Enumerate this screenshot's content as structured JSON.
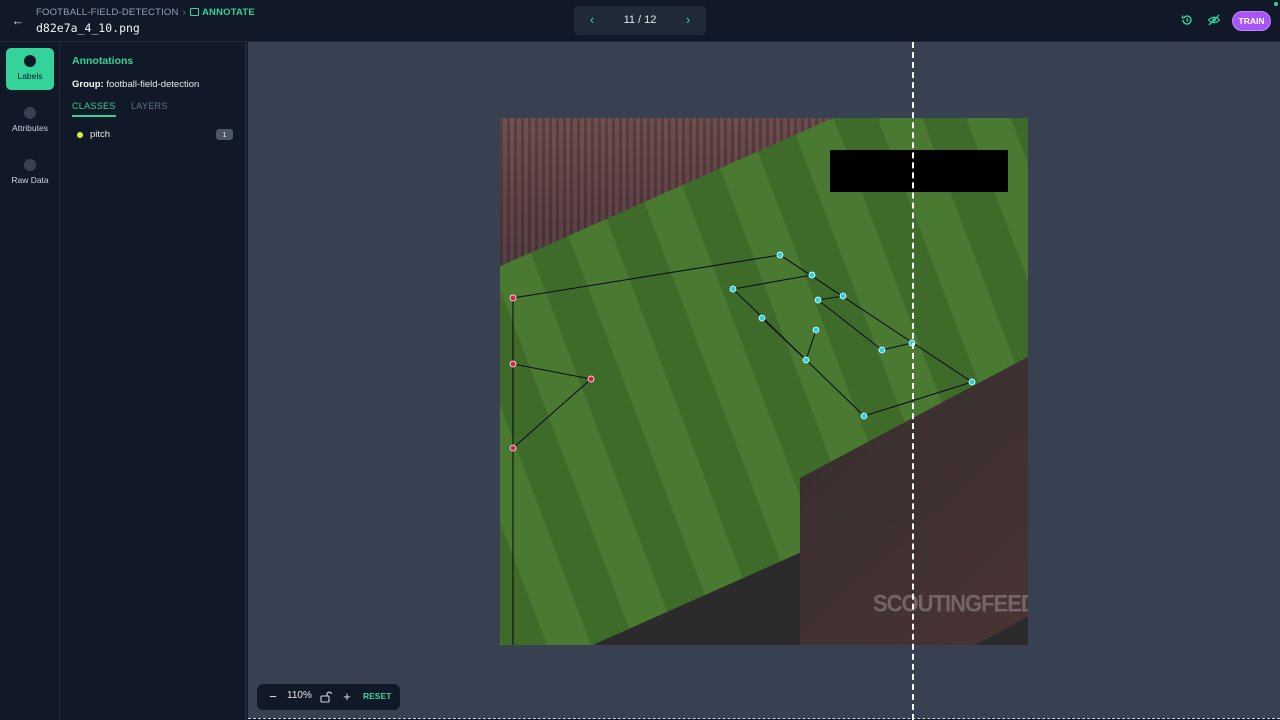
{
  "header": {
    "project_name": "FOOTBALL-FIELD-DETECTION",
    "breadcrumb_separator": "›",
    "mode_label": "ANNOTATE",
    "filename": "d82e7a_4_10.png",
    "pager": {
      "label": "11 / 12",
      "current": 11,
      "total": 12
    },
    "train_label": "TRAIN",
    "accent_color": "#34d399",
    "train_color": "#a855f7"
  },
  "rail": {
    "items": [
      {
        "label": "Labels",
        "icon": "tag-icon",
        "active": true
      },
      {
        "label": "Attributes",
        "icon": "list-icon",
        "active": false
      },
      {
        "label": "Raw Data",
        "icon": "code-icon",
        "active": false
      }
    ]
  },
  "panel": {
    "title": "Annotations",
    "group_label": "Group:",
    "group_value": "football-field-detection",
    "tabs": [
      {
        "label": "CLASSES",
        "active": true
      },
      {
        "label": "LAYERS",
        "active": false
      }
    ],
    "classes": [
      {
        "name": "pitch",
        "count": "1",
        "color": "#d9f13a"
      }
    ]
  },
  "canvas": {
    "watermark": "SCOUTINGFEED",
    "keypoint_colors": {
      "left_group": "#e11d48",
      "right_group": "#22d3ee"
    }
  },
  "zoom": {
    "minus_label": "−",
    "value": "110%",
    "plus_label": "+",
    "reset_label": "RESET"
  }
}
